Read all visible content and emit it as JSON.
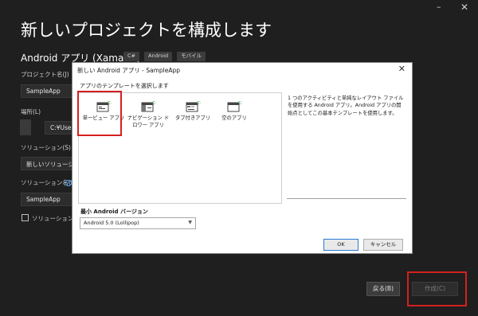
{
  "window": {
    "minimize_glyph": "–",
    "close_glyph": "✕"
  },
  "page_title": "新しいプロジェクトを構成します",
  "project_type": "Android アプリ (Xamarin)",
  "tags": [
    "C#",
    "Android",
    "モバイル"
  ],
  "fields": {
    "project_name_label": "プロジェクト名(J)",
    "project_name_value": "SampleApp",
    "location_label": "場所(L)",
    "location_value": "C:¥Users¥k-chimu",
    "solution_label": "ソリューション(S)",
    "solution_value": "新しいソリューションを",
    "solution_name_label": "ソリューション名(M)",
    "solution_name_value": "SampleApp",
    "same_dir_label": "ソリューションとプロ"
  },
  "footer": {
    "back_label": "戻る(B)",
    "create_label": "作成(C)"
  },
  "dialog": {
    "title": "新しい Android アプリ - SampleApp",
    "template_section_label": "アプリのテンプレートを選択します",
    "templates": [
      {
        "name": "単一ビュー アプリ",
        "icon": "single-view-icon",
        "selected": true
      },
      {
        "name": "ナビゲーション ドロワー アプリ",
        "icon": "navigation-drawer-icon",
        "selected": false
      },
      {
        "name": "タブ付きアプリ",
        "icon": "tabbed-app-icon",
        "selected": false
      },
      {
        "name": "空のアプリ",
        "icon": "blank-app-icon",
        "selected": false
      }
    ],
    "description": "1 つのアクティビティと単純なレイアウト ファイルを使用する Android アプリ。Android アプリの開始点としてこの基本テンプレートを使用します。",
    "min_version_label": "最小 Android バージョン",
    "min_version_value": "Android 5.0 (Lollipop)",
    "ok_label": "OK",
    "cancel_label": "キャンセル"
  },
  "colors": {
    "highlight": "#d42020",
    "accent_blue": "#2a7ad5",
    "icon_green": "#2e9e4a"
  }
}
